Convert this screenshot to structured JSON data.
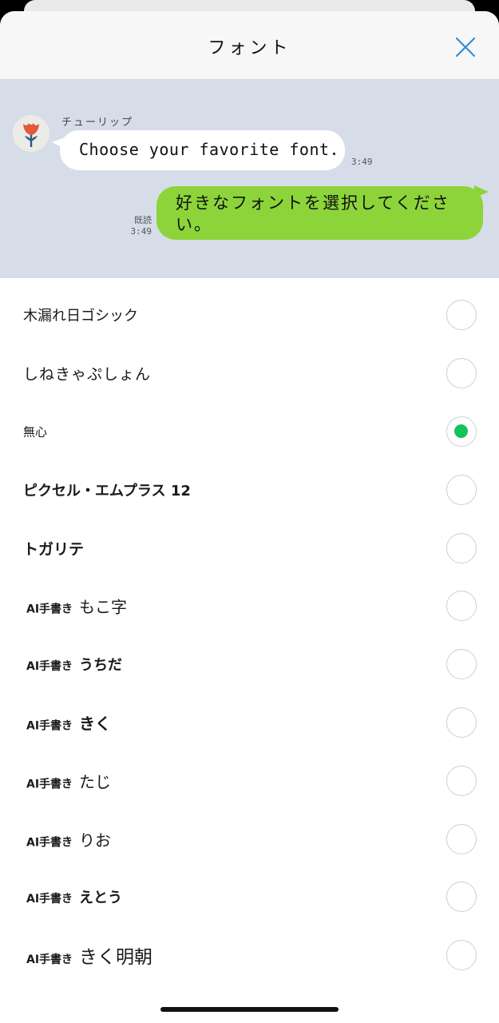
{
  "header": {
    "title": "フォント",
    "close_icon": "close-icon"
  },
  "preview": {
    "sender_name": "チューリップ",
    "incoming_message": "Choose your favorite font.",
    "incoming_time": "3:49",
    "read_label": "既読",
    "outgoing_time": "3:49",
    "outgoing_message": "好きなフォントを選択してください。",
    "avatar_icon": "tulip-icon",
    "colors": {
      "background": "#d6dde8",
      "outgoing_bubble": "#8cd43a",
      "incoming_bubble": "#ffffff"
    }
  },
  "fonts": [
    {
      "prefix": "",
      "name": "木漏れ日ゴシック",
      "selected": false
    },
    {
      "prefix": "",
      "name": "しねきゃぷしょん",
      "selected": false
    },
    {
      "prefix": "",
      "name": "無心",
      "selected": true
    },
    {
      "prefix": "",
      "name": "ピクセル・エムプラス 12",
      "selected": false
    },
    {
      "prefix": "",
      "name": "トガリテ",
      "selected": false
    },
    {
      "prefix": "AI手書き",
      "name": "もこ字",
      "selected": false
    },
    {
      "prefix": "AI手書き",
      "name": "うちだ",
      "selected": false
    },
    {
      "prefix": "AI手書き",
      "name": "きく",
      "selected": false
    },
    {
      "prefix": "AI手書き",
      "name": "たじ",
      "selected": false
    },
    {
      "prefix": "AI手書き",
      "name": "りお",
      "selected": false
    },
    {
      "prefix": "AI手書き",
      "name": "えとう",
      "selected": false
    },
    {
      "prefix": "AI手書き",
      "name": "きく明朝",
      "selected": false
    }
  ],
  "accent_color": "#12c25a"
}
